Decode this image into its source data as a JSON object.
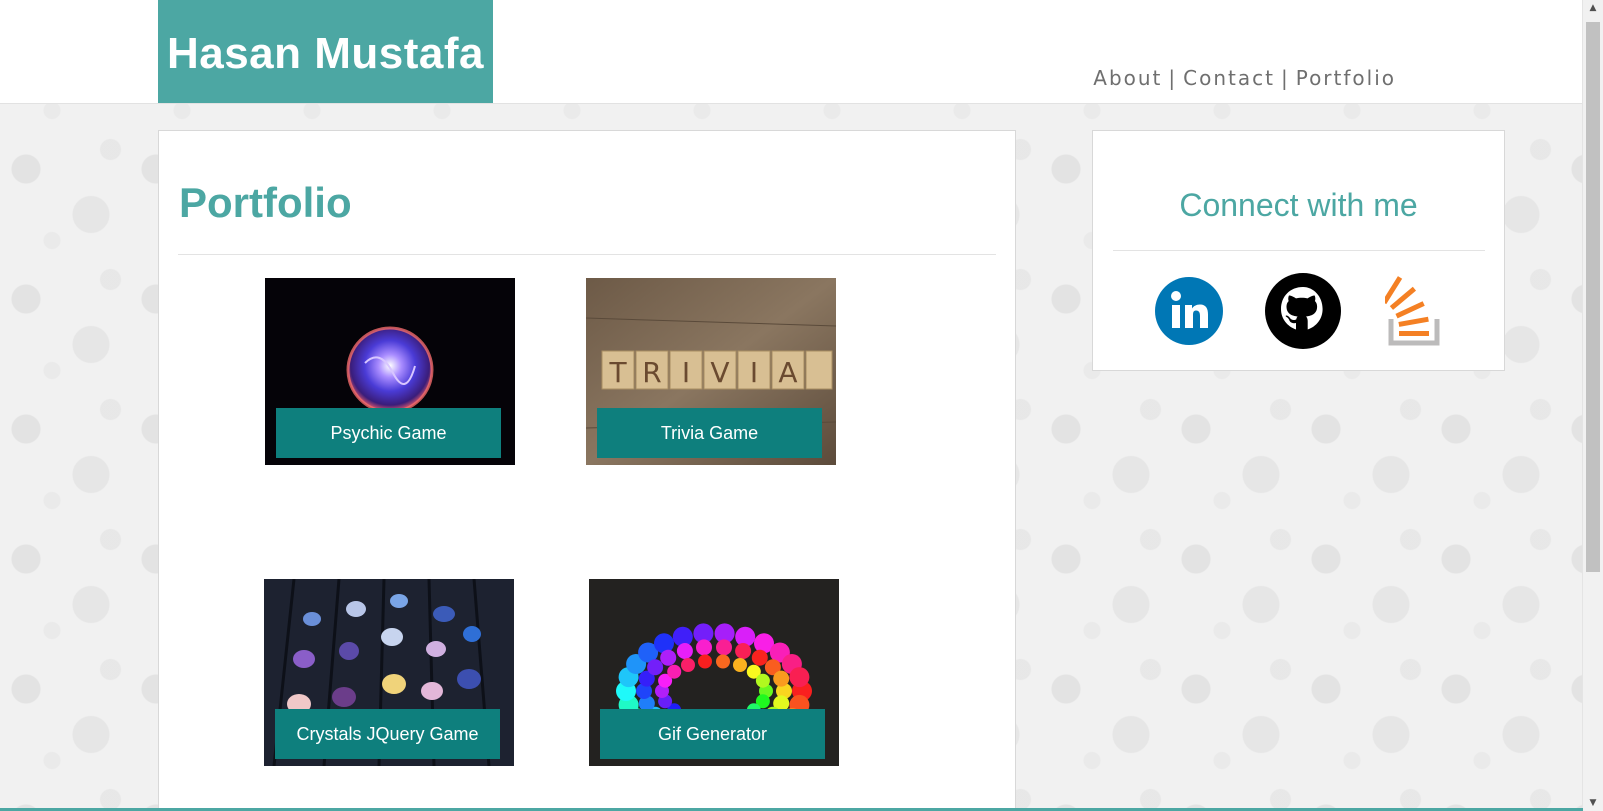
{
  "header": {
    "brand": "Hasan Mustafa",
    "nav": [
      {
        "label": "About"
      },
      {
        "label": "Contact"
      },
      {
        "label": "Portfolio"
      }
    ],
    "separator": "|"
  },
  "main": {
    "title": "Portfolio",
    "projects": [
      {
        "label": "Psychic Game",
        "image": "crystal-ball-image"
      },
      {
        "label": "Trivia Game",
        "image": "trivia-blocks-image"
      },
      {
        "label": "Crystals JQuery Game",
        "image": "crystals-image"
      },
      {
        "label": "Gif Generator",
        "image": "rainbow-dots-image"
      }
    ]
  },
  "sidebar": {
    "title": "Connect with me",
    "links": [
      {
        "icon": "linkedin-icon",
        "color": "#0077b5"
      },
      {
        "icon": "github-icon",
        "color": "#000000"
      },
      {
        "icon": "stackoverflow-icon",
        "color": "#f48024"
      }
    ]
  },
  "colors": {
    "accent": "#4ca7a3",
    "button": "#0e7f7d",
    "nav_text": "#6f6f6f"
  }
}
